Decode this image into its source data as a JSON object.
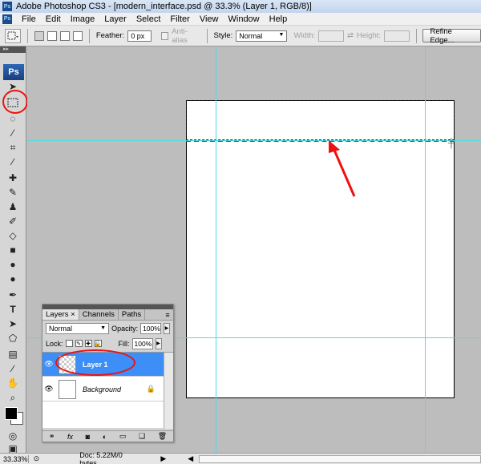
{
  "window": {
    "title": "Adobe Photoshop CS3 - [modern_interface.psd @ 33.3% (Layer 1, RGB/8)]",
    "app_icon": "Ps"
  },
  "menu": {
    "items": [
      "File",
      "Edit",
      "Image",
      "Layer",
      "Select",
      "Filter",
      "View",
      "Window",
      "Help"
    ]
  },
  "options": {
    "feather_label": "Feather:",
    "feather_value": "0 px",
    "antialias_label": "Anti-alias",
    "style_label": "Style:",
    "style_value": "Normal",
    "width_label": "Width:",
    "height_label": "Height:",
    "refine_label": "Refine Edge..."
  },
  "toolbox": {
    "logo": "Ps",
    "grip": "▸▸"
  },
  "status": {
    "zoom": "33.33%",
    "doc": "Doc: 5.22M/0 bytes"
  },
  "layers_panel": {
    "tabs": [
      "Layers",
      "Channels",
      "Paths"
    ],
    "blend_mode": "Normal",
    "opacity_label": "Opacity:",
    "opacity_value": "100%",
    "lock_label": "Lock:",
    "fill_label": "Fill:",
    "fill_value": "100%",
    "layers": [
      {
        "name": "Layer 1",
        "selected": true
      },
      {
        "name": "Background",
        "selected": false
      }
    ],
    "footer_icons": [
      "link-icon",
      "fx-icon",
      "mask-icon",
      "adjustment-icon",
      "group-icon",
      "new-layer-icon",
      "trash-icon"
    ]
  },
  "annotation_color": "#e11111"
}
